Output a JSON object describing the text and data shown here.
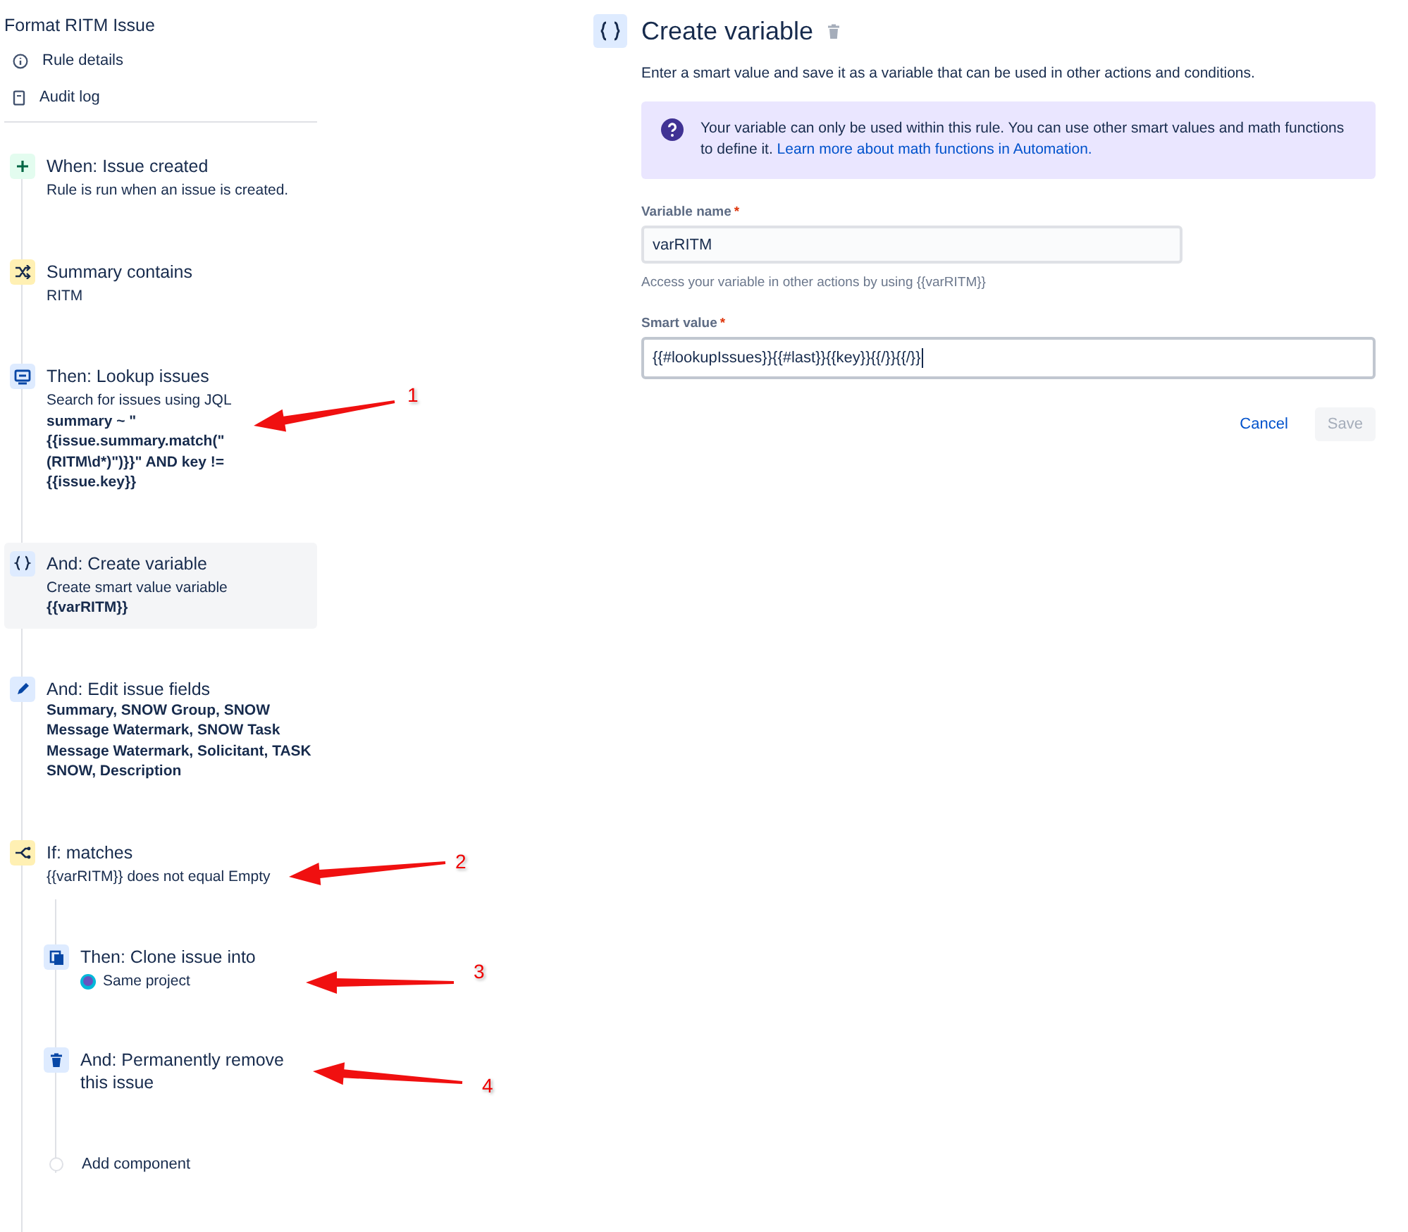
{
  "rule": {
    "title": "Format RITM Issue",
    "nav": [
      {
        "kind": "info",
        "label": "Rule details"
      },
      {
        "kind": "log",
        "label": "Audit log"
      }
    ]
  },
  "steps": [
    {
      "kind": "trigger",
      "title": "When: Issue created",
      "description": "Rule is run when an issue is created.",
      "selected": false
    },
    {
      "kind": "condition",
      "title": "Summary contains",
      "description": "RITM",
      "selected": false
    },
    {
      "kind": "lookup",
      "title": "Then: Lookup issues",
      "description": "Search for issues using JQL",
      "detail": "summary ~ \"{{issue.summary.match(\"(RITM\\d*)\")}}\" AND key != {{issue.key}}",
      "selected": false
    },
    {
      "kind": "variable",
      "title": "And: Create variable",
      "description": "Create smart value variable",
      "detail": "{{varRITM}}",
      "selected": true
    },
    {
      "kind": "edit",
      "title": "And: Edit issue fields",
      "detail": "Summary, SNOW Group, SNOW Message Watermark, SNOW Task Message Watermark, Solicitant, TASK SNOW, Description",
      "selected": false
    },
    {
      "kind": "branch",
      "title": "If: matches",
      "description": "{{varRITM}} does not equal Empty",
      "selected": false,
      "children": [
        {
          "kind": "clone",
          "title": "Then: Clone issue into",
          "project": "Same project",
          "selected": false
        },
        {
          "kind": "delete",
          "title": "And: Permanently remove this issue",
          "selected": false
        },
        {
          "kind": "add",
          "title": "Add component",
          "selected": false
        }
      ]
    }
  ],
  "panel": {
    "title": "Create variable",
    "description": "Enter a smart value and save it as a variable that can be used in other actions and conditions.",
    "info": {
      "text": "Your variable can only be used within this rule. You can use other smart values and math functions to define it.",
      "link": "Learn more about math functions in Automation."
    },
    "fields": [
      {
        "label": "Variable name",
        "required_mark": "*",
        "value": "varRITM",
        "helper": "Access your variable in other actions by using {{varRITM}}",
        "focused": false,
        "wide": false
      },
      {
        "label": "Smart value",
        "required_mark": "*",
        "value": "{{#lookupIssues}}{{#last}}{{key}}{{/}}{{/}}",
        "focused": true,
        "wide": true
      }
    ],
    "buttons": [
      {
        "kind": "link",
        "label": "Cancel",
        "disabled": false
      },
      {
        "kind": "primary",
        "label": "Save",
        "disabled": true
      }
    ]
  },
  "annotations": [
    {
      "label": "1"
    },
    {
      "label": "2"
    },
    {
      "label": "3"
    },
    {
      "label": "4"
    }
  ]
}
